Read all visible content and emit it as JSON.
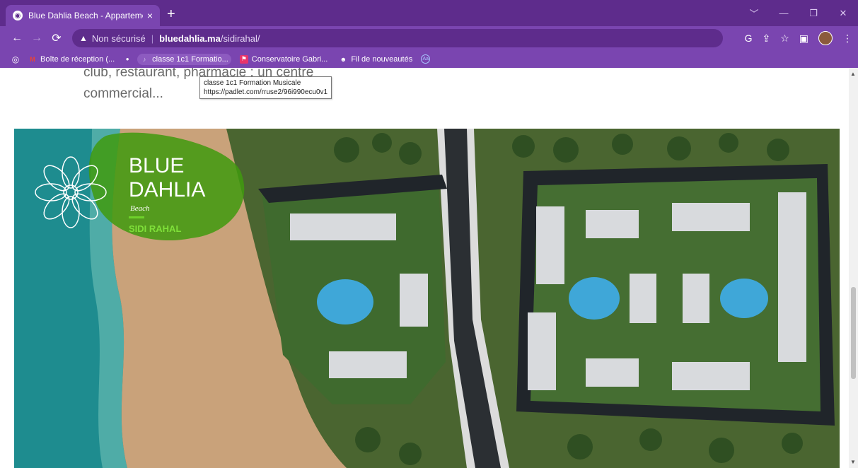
{
  "browser": {
    "tab_title": "Blue Dahlia Beach - Appartemen",
    "tab_close": "×",
    "new_tab": "+",
    "security_label": "Non sécurisé",
    "url_host": "bluedahlia.ma",
    "url_path": "/sidirahal/",
    "window_controls": [
      "﹀",
      "—",
      "❐",
      "✕"
    ]
  },
  "bookmarks": [
    {
      "label": "Boîte de réception (...",
      "icon": "gmail-icon"
    },
    {
      "label": "classe 1c1 Formatio...",
      "icon": "padlet-icon"
    },
    {
      "label": "Conservatoire Gabri...",
      "icon": "flag-icon"
    },
    {
      "label": "Fil de nouveautés",
      "icon": "feed-icon"
    }
  ],
  "tooltip": {
    "line1": "classe 1c1 Formation Musicale",
    "line2": "https://padlet.com/rruse2/96i990ecu0v1"
  },
  "page": {
    "text_line1": "club, restaurant, pharmacie : un centre",
    "text_line2": "commercial..."
  },
  "logo": {
    "line1": "BLUE",
    "line2": "DAHLIA",
    "script": "Beach",
    "location": "SIDI RAHAL"
  },
  "colors": {
    "chrome_dark": "#5e2c8c",
    "chrome_light": "#7a45b0",
    "logo_green": "#3f9a0e",
    "sea": "#1f8a8a",
    "sand": "#c9a27a",
    "grass": "#4d6b35",
    "pool": "#3fa7d8"
  }
}
